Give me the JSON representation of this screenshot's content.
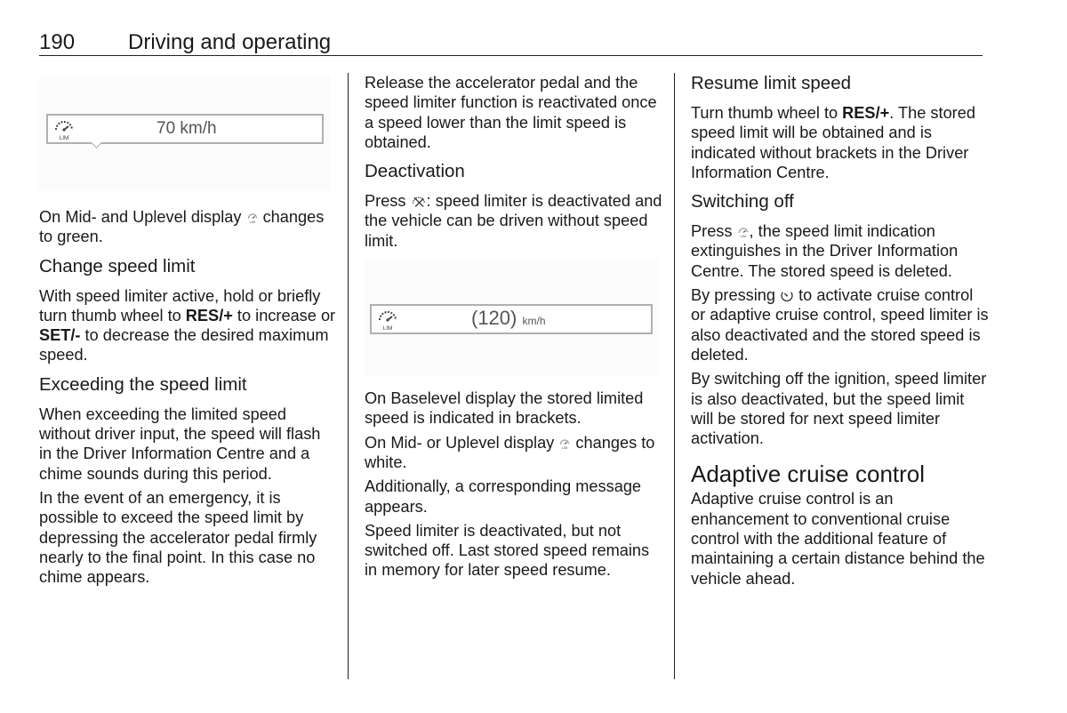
{
  "header": {
    "page_number": "190",
    "section_title": "Driving and operating"
  },
  "column1": {
    "display1": {
      "icon": "speed-limiter-lim-icon",
      "speed_text": "70 km/h"
    },
    "para_green_a": "On Mid- and Uplevel display ",
    "para_green_b": " changes to green.",
    "h_change": "Change speed limit",
    "para_change_a": "With speed limiter active, hold or briefly turn thumb wheel to ",
    "para_change_res": "RES/+",
    "para_change_b": " to increase or ",
    "para_change_set": "SET/-",
    "para_change_c": " to decrease the desired maximum speed.",
    "h_exceed": "Exceeding the speed limit",
    "para_exceed1": "When exceeding the limited speed without driver input, the speed will flash in the Driver Information Centre and a chime sounds during this period.",
    "para_exceed2": "In the event of an emergency, it is possible to exceed the speed limit by depressing the accelerator pedal firmly nearly to the final point. In this case no chime appears."
  },
  "column2": {
    "para_release": "Release the accelerator pedal and the speed limiter function is reactivated once a speed lower than the limit speed is obtained.",
    "h_deact": "Deactivation",
    "para_deact_a": "Press ",
    "para_deact_b": ": speed limiter is deactivated and the vehicle can be driven without speed limit.",
    "display2": {
      "icon": "speed-limiter-lim-icon",
      "speed_value": "(120)",
      "unit": "km/h"
    },
    "para_base": "On Baselevel display the stored limited speed is indicated in brackets.",
    "para_white_a": "On Mid- or Uplevel display ",
    "para_white_b": " changes to white.",
    "para_message": "Additionally, a corresponding message appears.",
    "para_notoff": "Speed limiter is deactivated, but not switched off. Last stored speed remains in memory for later speed resume."
  },
  "column3": {
    "h_resume": "Resume limit speed",
    "para_resume_a": "Turn thumb wheel to ",
    "para_resume_res": "RES/+",
    "para_resume_b": ". The stored speed limit will be obtained and is indicated without brackets in the Driver Information Centre.",
    "h_switch": "Switching off",
    "para_switch_a": "Press ",
    "para_switch_b": ", the speed limit indication extinguishes in the Driver Information Centre. The stored speed is deleted.",
    "para_cruise_a": "By pressing ",
    "para_cruise_b": " to activate cruise control or adaptive cruise control, speed limiter is also deactivated and the stored speed is deleted.",
    "para_ignition": "By switching off the ignition, speed limiter is also deactivated, but the speed limit will be stored for next speed limiter activation.",
    "h_acc": "Adaptive cruise control",
    "para_acc": "Adaptive cruise control is an enhancement to conventional cruise control with the additional feature of maintaining a certain distance behind the vehicle ahead."
  }
}
